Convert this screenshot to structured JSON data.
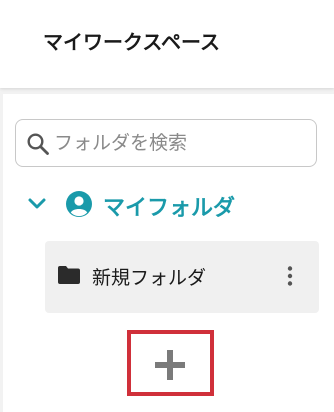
{
  "header": {
    "title": "マイワークスペース"
  },
  "search": {
    "placeholder": "フォルダを検索",
    "value": "",
    "icon": "search-icon"
  },
  "tree": {
    "root": {
      "label": "マイフォルダ",
      "expanded": true,
      "icon": "user-circle-icon",
      "color": "#1a9aaa"
    },
    "items": [
      {
        "label": "新規フォルダ",
        "icon": "folder-icon",
        "menu_icon": "kebab-menu-icon"
      }
    ]
  },
  "add_button": {
    "icon": "plus-icon",
    "highlight_color": "#d0303a"
  }
}
